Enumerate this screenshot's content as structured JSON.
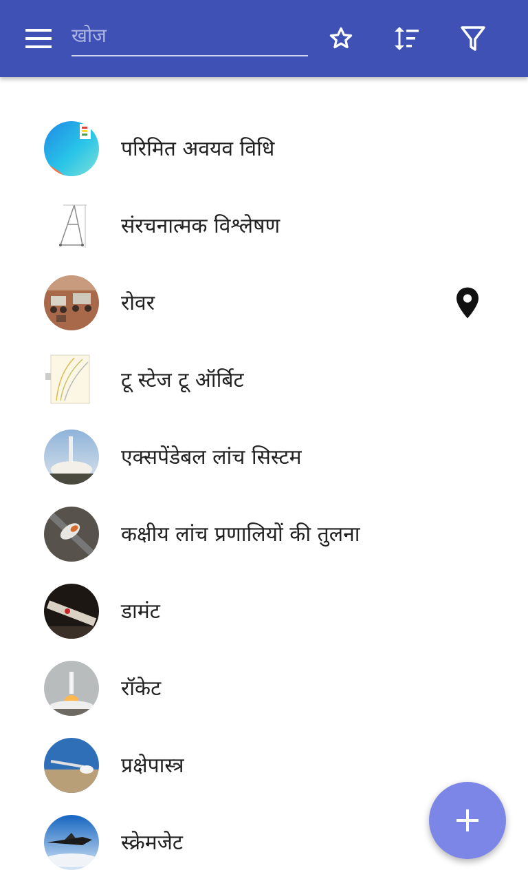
{
  "appbar": {
    "color": "#3f51b5",
    "menu_icon": "menu-icon",
    "search_placeholder": "खोज",
    "search_value": "",
    "actions": [
      "star-outline-icon",
      "sort-icon",
      "filter-icon"
    ]
  },
  "list": {
    "items": [
      {
        "label": "परिमित अवयव विधि",
        "thumb": "finite-element-image"
      },
      {
        "label": "संरचनात्मक विश्लेषण",
        "thumb": "structure-diagram-image"
      },
      {
        "label": "रोवर",
        "thumb": "rover-image",
        "trailing_icon": "map-pin-icon"
      },
      {
        "label": "टू स्टेज टू ऑर्बिट",
        "thumb": "graph-image"
      },
      {
        "label": "एक्सपेंडेबल लांच सिस्टम",
        "thumb": "rocket-launch-image"
      },
      {
        "label": "कक्षीय लांच प्रणालियों की तुलना",
        "thumb": "spacecraft-image"
      },
      {
        "label": "डामंट",
        "thumb": "rocket-assembly-image"
      },
      {
        "label": "रॉकेट",
        "thumb": "rocket-liftoff-image"
      },
      {
        "label": "प्रक्षेपास्त्र",
        "thumb": "missile-launch-image"
      },
      {
        "label": "स्क्रेमजेट",
        "thumb": "scramjet-aircraft-image"
      }
    ]
  },
  "fab": {
    "icon": "plus-icon",
    "color": "#7b86e6"
  }
}
